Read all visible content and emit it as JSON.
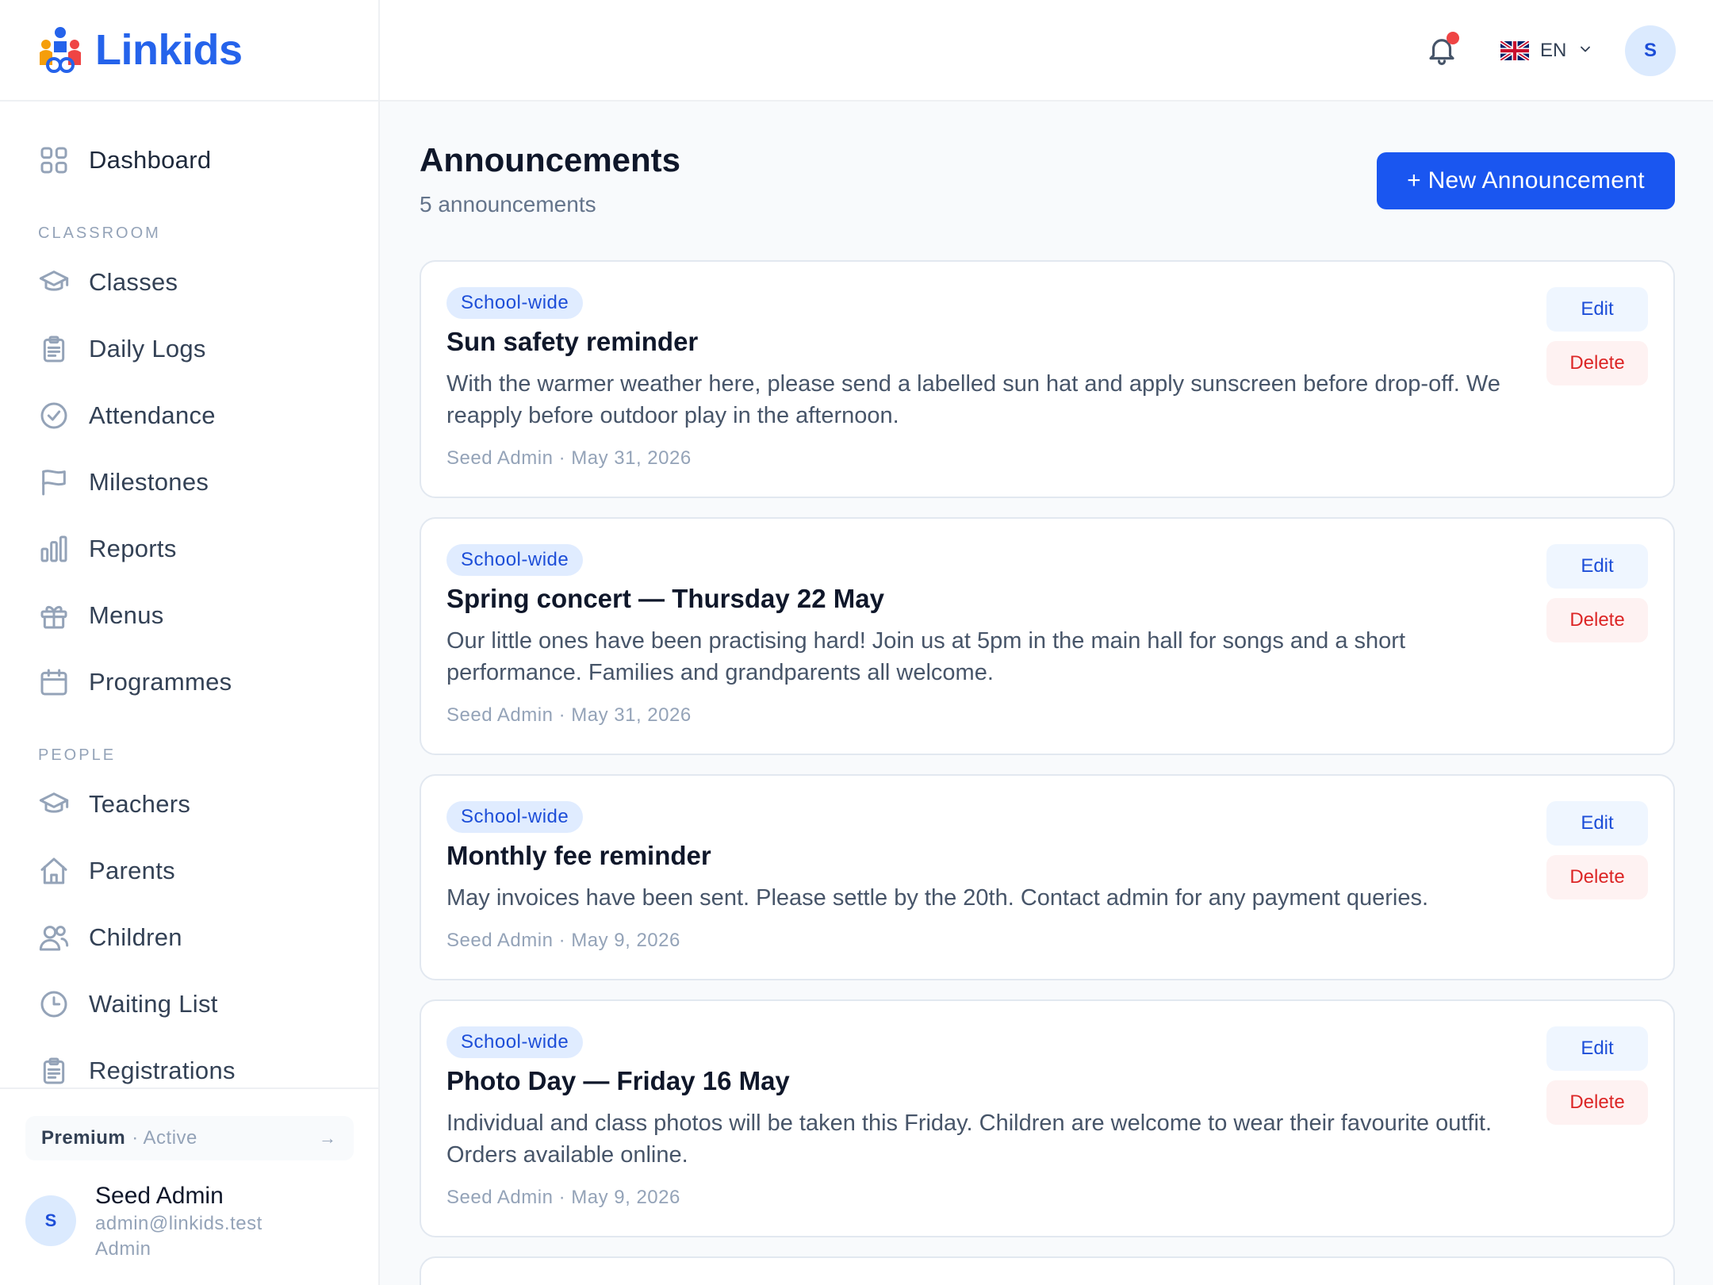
{
  "app": {
    "name": "Linkids"
  },
  "sidebar": {
    "dashboard": "Dashboard",
    "sections": [
      {
        "label": "CLASSROOM"
      },
      {
        "label": "PEOPLE"
      }
    ],
    "classroom_items": [
      {
        "label": "Classes",
        "icon": "graduation-cap-icon"
      },
      {
        "label": "Daily Logs",
        "icon": "clipboard-icon"
      },
      {
        "label": "Attendance",
        "icon": "check-badge-icon"
      },
      {
        "label": "Milestones",
        "icon": "flag-icon"
      },
      {
        "label": "Reports",
        "icon": "bar-chart-icon"
      },
      {
        "label": "Menus",
        "icon": "gift-icon"
      },
      {
        "label": "Programmes",
        "icon": "calendar-icon"
      }
    ],
    "people_items": [
      {
        "label": "Teachers",
        "icon": "graduation-cap-icon"
      },
      {
        "label": "Parents",
        "icon": "home-icon"
      },
      {
        "label": "Children",
        "icon": "users-icon"
      },
      {
        "label": "Waiting List",
        "icon": "clock-icon"
      },
      {
        "label": "Registrations",
        "icon": "clipboard-icon"
      }
    ],
    "plan": {
      "name": "Premium",
      "status": "· Active",
      "arrow": "→"
    },
    "user": {
      "initial": "S",
      "name": "Seed Admin",
      "email": "admin@linkids.test",
      "role": "Admin"
    }
  },
  "header": {
    "language": "EN",
    "avatar_initial": "S"
  },
  "main": {
    "title": "Announcements",
    "count_text": "5 announcements",
    "new_button": "+ New Announcement",
    "edit_label": "Edit",
    "delete_label": "Delete",
    "announcements": [
      {
        "badge": "School-wide",
        "title": "Sun safety reminder",
        "body": "With the warmer weather here, please send a labelled sun hat and apply sunscreen before drop-off. We reapply before outdoor play in the afternoon.",
        "meta": "Seed Admin · May 31, 2026"
      },
      {
        "badge": "School-wide",
        "title": "Spring concert — Thursday 22 May",
        "body": "Our little ones have been practising hard! Join us at 5pm in the main hall for songs and a short performance. Families and grandparents all welcome.",
        "meta": "Seed Admin · May 31, 2026"
      },
      {
        "badge": "School-wide",
        "title": "Monthly fee reminder",
        "body": "May invoices have been sent. Please settle by the 20th. Contact admin for any payment queries.",
        "meta": "Seed Admin · May 9, 2026"
      },
      {
        "badge": "School-wide",
        "title": "Photo Day — Friday 16 May",
        "body": "Individual and class photos will be taken this Friday. Children are welcome to wear their favourite outfit. Orders available online.",
        "meta": "Seed Admin · May 9, 2026"
      }
    ]
  },
  "colors": {
    "accent": "#1a56f0",
    "badge_bg": "#e0ecff",
    "delete": "#dc2626",
    "notification_dot": "#ef4444"
  }
}
